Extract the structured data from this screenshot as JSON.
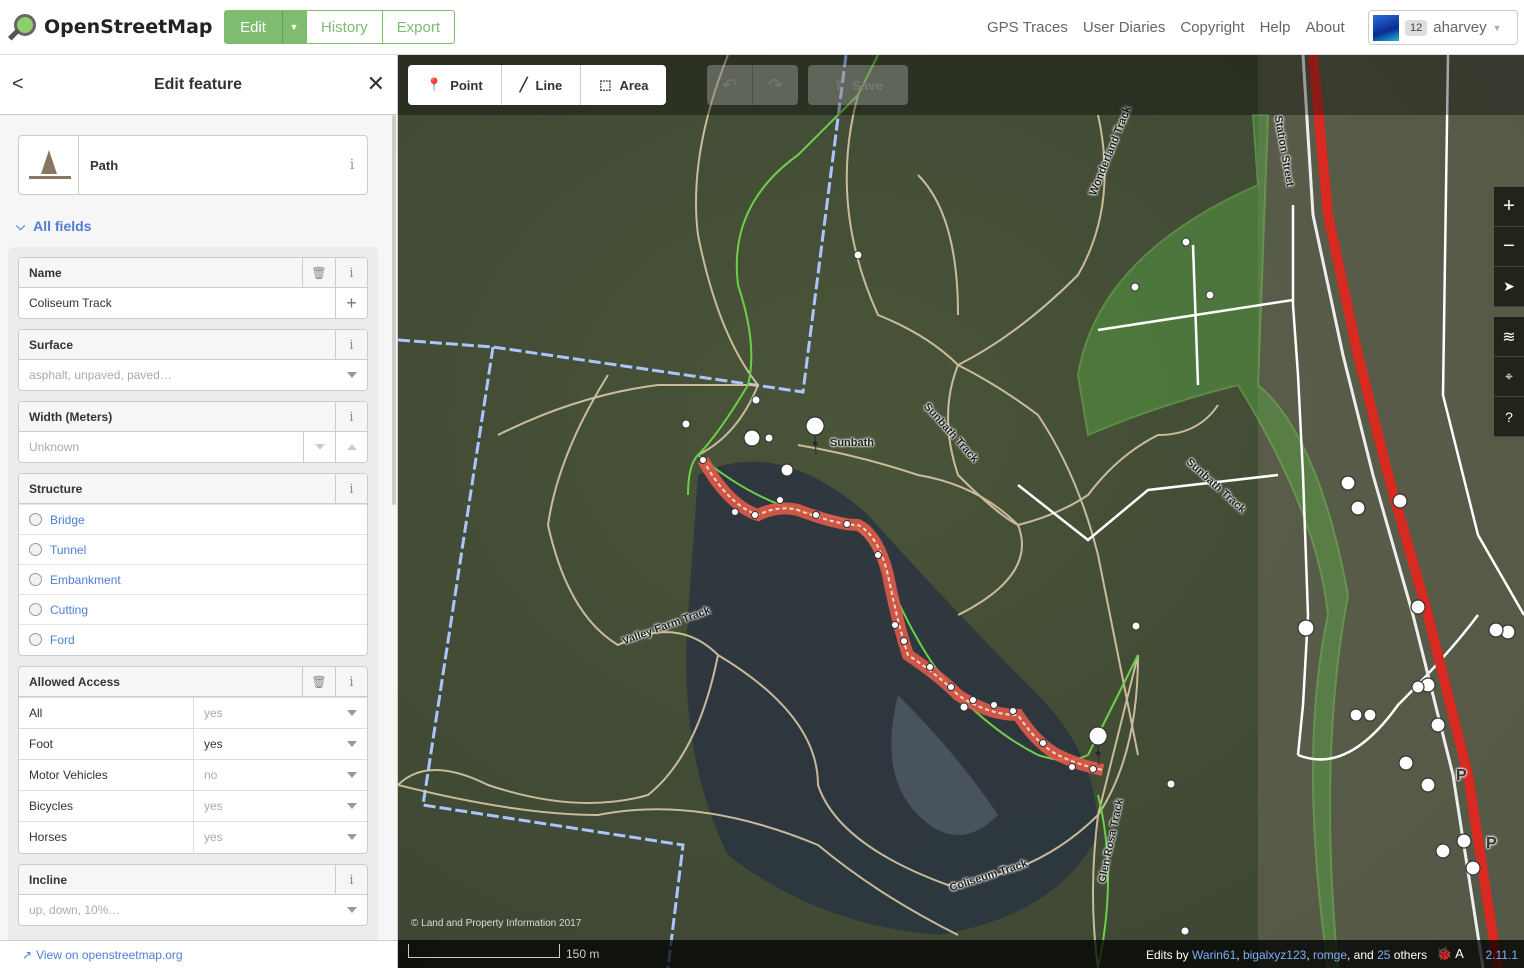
{
  "header": {
    "brand": "OpenStreetMap",
    "edit_label": "Edit",
    "history_label": "History",
    "export_label": "Export",
    "links": [
      "GPS Traces",
      "User Diaries",
      "Copyright",
      "Help",
      "About"
    ],
    "user": {
      "count": "12",
      "name": "aharvey"
    }
  },
  "sidebar": {
    "title": "Edit feature",
    "preset_name": "Path",
    "all_fields_label": "All fields",
    "name_field": {
      "label": "Name",
      "value": "Coliseum Track"
    },
    "surface_field": {
      "label": "Surface",
      "placeholder": "asphalt, unpaved, paved…"
    },
    "width_field": {
      "label": "Width (Meters)",
      "placeholder": "Unknown"
    },
    "structure_field": {
      "label": "Structure",
      "options": [
        "Bridge",
        "Tunnel",
        "Embankment",
        "Cutting",
        "Ford"
      ]
    },
    "access_field": {
      "label": "Allowed Access",
      "rows": [
        {
          "key": "All",
          "value": "yes"
        },
        {
          "key": "Foot",
          "value": "yes"
        },
        {
          "key": "Motor Vehicles",
          "value": "no"
        },
        {
          "key": "Bicycles",
          "value": "yes"
        },
        {
          "key": "Horses",
          "value": "yes"
        }
      ]
    },
    "incline_field": {
      "label": "Incline",
      "placeholder": "up, down, 10%…"
    },
    "footer_link": "View on openstreetmap.org"
  },
  "map": {
    "modes": [
      "Point",
      "Line",
      "Area"
    ],
    "save_label": "Save",
    "attribution": "© Land and Property Information 2017",
    "scale_label": "150 m",
    "edits_by_prefix": "Edits by",
    "editors": [
      "Warin61",
      "bigalxyz123",
      "romge"
    ],
    "and_text": ", and",
    "others_count": "25",
    "others_text": "others",
    "version": "2.11.1",
    "labels": [
      "Sunbath",
      "Sunbath Track",
      "Sunbath Track",
      "Wonderland Track",
      "Station Street",
      "Valley Farm Track",
      "Coliseum Track",
      "Glen Rosa Track",
      "P",
      "P"
    ]
  }
}
